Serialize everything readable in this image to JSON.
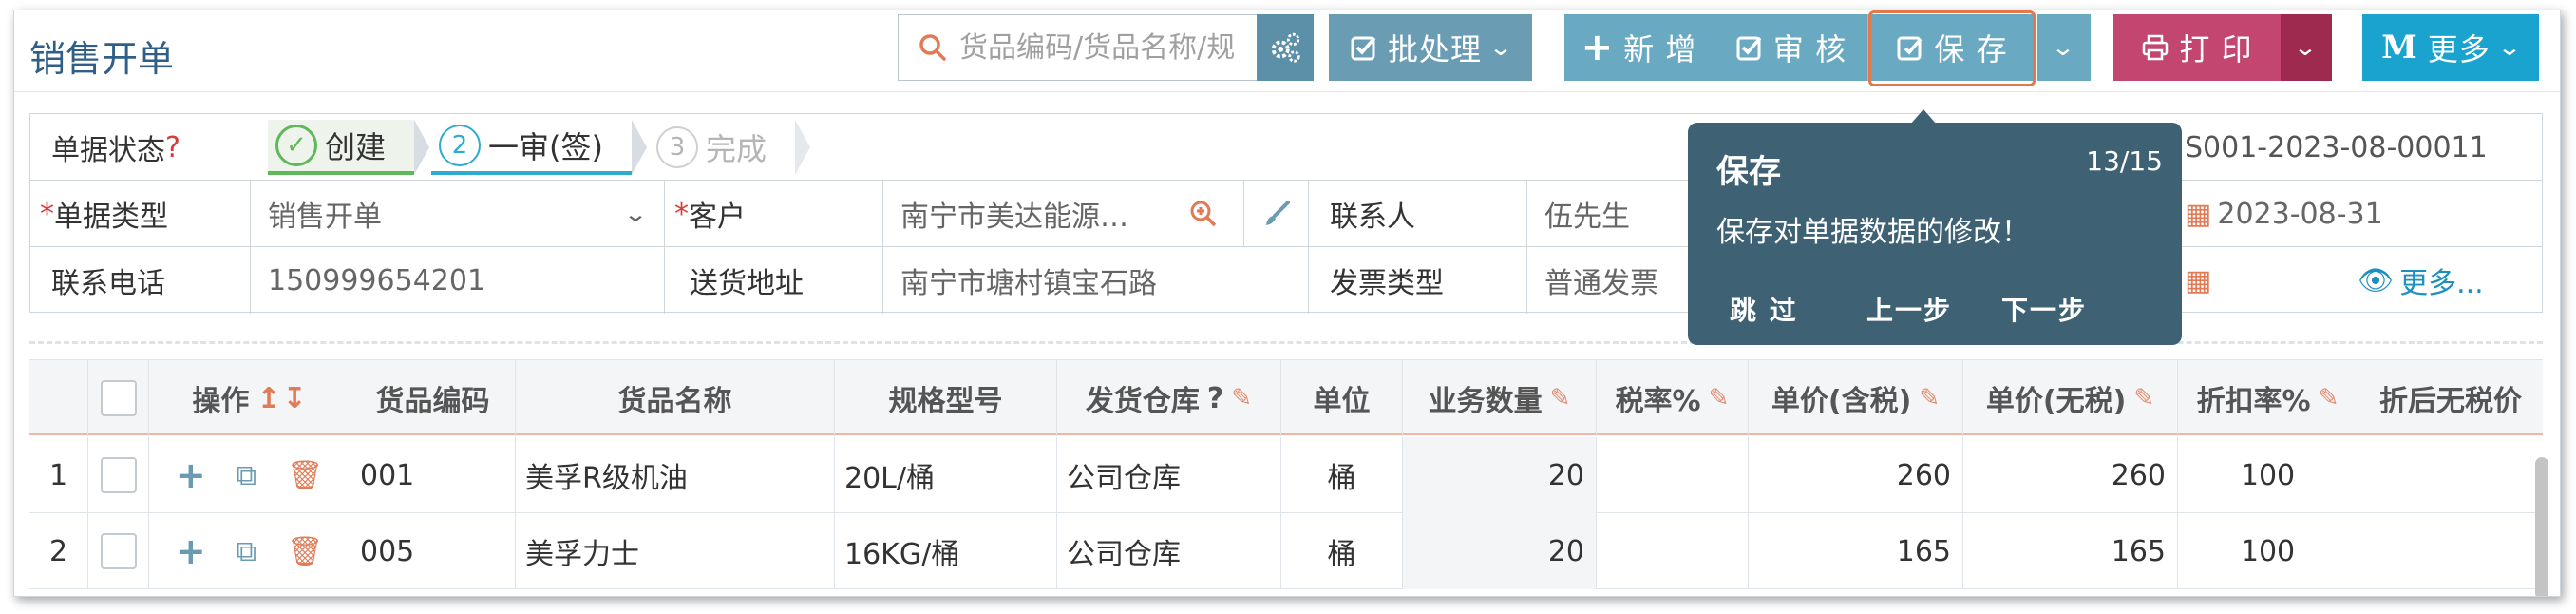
{
  "page": {
    "title": "销售开单"
  },
  "search": {
    "placeholder": "货品编码/货品名称/规"
  },
  "toolbar": {
    "batch_label": "批处理",
    "add_label": "新 增",
    "audit_label": "审 核",
    "save_label": "保 存",
    "print_label": "打 印",
    "more_label": "更多"
  },
  "form": {
    "status_label": "单据状态",
    "status_help": "?",
    "steps": [
      {
        "num": "✓",
        "label": "创建"
      },
      {
        "num": "2",
        "label": "一审(签)"
      },
      {
        "num": "3",
        "label": "完成"
      }
    ],
    "order_no": "S001-2023-08-00011",
    "doc_type_label": "单据类型",
    "doc_type_value": "销售开单",
    "customer_label": "客户",
    "customer_value": "南宁市美达能源…",
    "contact_label": "联系人",
    "contact_value": "伍先生",
    "date_value": "2023-08-31",
    "phone_label": "联系电话",
    "phone_value": "150999654201",
    "address_label": "送货地址",
    "address_value": "南宁市塘村镇宝石路",
    "invoice_label": "发票类型",
    "invoice_value": "普通发票",
    "more_link": "更多..."
  },
  "tooltip": {
    "title": "保存",
    "counter": "13/15",
    "body": "保存对单据数据的修改！",
    "skip": "跳 过",
    "prev": "上一步",
    "next": "下一步"
  },
  "grid": {
    "headers": {
      "ops": "操作",
      "code": "货品编码",
      "name": "货品名称",
      "spec": "规格型号",
      "warehouse": "发货仓库",
      "unit": "单位",
      "qty": "业务数量",
      "tax_rate": "税率%",
      "price_tax": "单价(含税)",
      "price_notax": "单价(无税)",
      "discount": "折扣率%",
      "after_discount": "折后无税价"
    },
    "rows": [
      {
        "no": "1",
        "code": "001",
        "name": "美孚R级机油",
        "spec": "20L/桶",
        "warehouse": "公司仓库",
        "unit": "桶",
        "qty": "20",
        "tax_rate": "",
        "price_tax": "260",
        "price_notax": "260",
        "discount": "100"
      },
      {
        "no": "2",
        "code": "005",
        "name": "美孚力士",
        "spec": "16KG/桶",
        "warehouse": "公司仓库",
        "unit": "桶",
        "qty": "20",
        "tax_rate": "",
        "price_tax": "165",
        "price_notax": "165",
        "discount": "100"
      }
    ]
  },
  "colors": {
    "accent": "#6a9db4",
    "print": "#c2466f",
    "more": "#1ba3cf",
    "tooltip": "#3e6273",
    "highlight": "#e4774b"
  }
}
